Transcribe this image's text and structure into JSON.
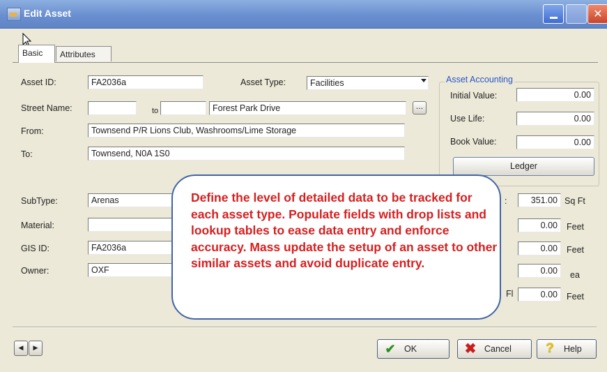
{
  "window": {
    "title": "Edit Asset"
  },
  "tabs": [
    {
      "label": "Basic",
      "active": true
    },
    {
      "label": "Attributes",
      "active": false
    }
  ],
  "basic": {
    "asset_id_label": "Asset ID:",
    "asset_id_value": "FA2036a",
    "asset_type_label": "Asset Type:",
    "asset_type_value": "Facilities",
    "street_name_label": "Street Name:",
    "street_from_value": "",
    "to_small_label": "to",
    "street_to_value": "",
    "street_value": "Forest Park Drive",
    "browse_label": "...",
    "from_label": "From:",
    "from_value": "Townsend P/R Lions Club, Washrooms/Lime Storage",
    "to_label": "To:",
    "to_value": "Townsend, N0A 1S0",
    "subtype_label": "SubType:",
    "subtype_value": "Arenas",
    "material_label": "Material:",
    "material_value": "",
    "gis_id_label": "GIS ID:",
    "gis_id_value": "FA2036a",
    "owner_label": "Owner:",
    "owner_value": "OXF"
  },
  "accounting": {
    "title": "Asset Accounting",
    "initial_value_label": "Initial Value:",
    "initial_value": "0.00",
    "use_life_label": "Use Life:",
    "use_life": "0.00",
    "book_value_label": "Book Value:",
    "book_value": "0.00",
    "ledger_button": "Ledger"
  },
  "measurements": {
    "rows": [
      {
        "label_fragment": ":",
        "value": "351.00",
        "unit": "Sq Ft"
      },
      {
        "label_fragment": "",
        "value": "0.00",
        "unit": "Feet"
      },
      {
        "label_fragment": "",
        "value": "0.00",
        "unit": "Feet"
      },
      {
        "label_fragment": "",
        "value": "0.00",
        "unit": "ea"
      },
      {
        "label_fragment": "Fl",
        "value": "0.00",
        "unit": "Feet"
      }
    ]
  },
  "callout": {
    "text": "Define the level of detailed data to be tracked for each asset type. Populate fields with drop lists and lookup tables to ease data entry and enforce accuracy. Mass update the setup of an asset to other similar assets and avoid duplicate entry.",
    "text_color": "#d61f1f",
    "border_color": "#4063a8"
  },
  "buttons": {
    "ok": "OK",
    "cancel": "Cancel",
    "help": "Help",
    "nav_prev": "◀",
    "nav_next": "▶"
  },
  "icons": {
    "app": "asset-app-icon",
    "ok": "check-icon",
    "cancel": "x-icon",
    "help": "question-mark-icon"
  },
  "colors": {
    "titlebar": "#6a8fd0",
    "dialog_bg": "#ece9d8",
    "accent_blue": "#2a56c6"
  }
}
